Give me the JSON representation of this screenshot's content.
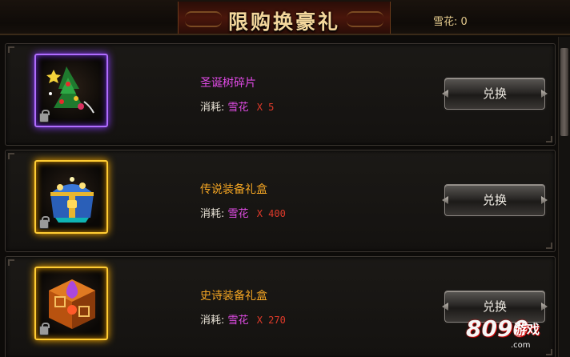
{
  "header": {
    "title": "限购换豪礼",
    "currency_display": "雪花: 0"
  },
  "items": [
    {
      "name": "圣诞树碎片",
      "name_color": "#e04ae6",
      "frame": "purple",
      "icon": "christmas-tree-fragment-icon",
      "cost_label": "消耗:",
      "cost_currency": "雪花",
      "cost_amount": "X 5",
      "button_label": "兑换"
    },
    {
      "name": "传说装备礼盒",
      "name_color": "#f5a623",
      "frame": "gold",
      "icon": "treasure-chest-icon",
      "cost_label": "消耗:",
      "cost_currency": "雪花",
      "cost_amount": "X 400",
      "button_label": "兑换"
    },
    {
      "name": "史诗装备礼盒",
      "name_color": "#f5a623",
      "frame": "gold",
      "icon": "epic-cube-box-icon",
      "cost_label": "消耗:",
      "cost_currency": "雪花",
      "cost_amount": "X 270",
      "button_label": "兑换"
    }
  ],
  "watermark": {
    "digits": "8090",
    "text": "游戏",
    "domain": ".com"
  }
}
